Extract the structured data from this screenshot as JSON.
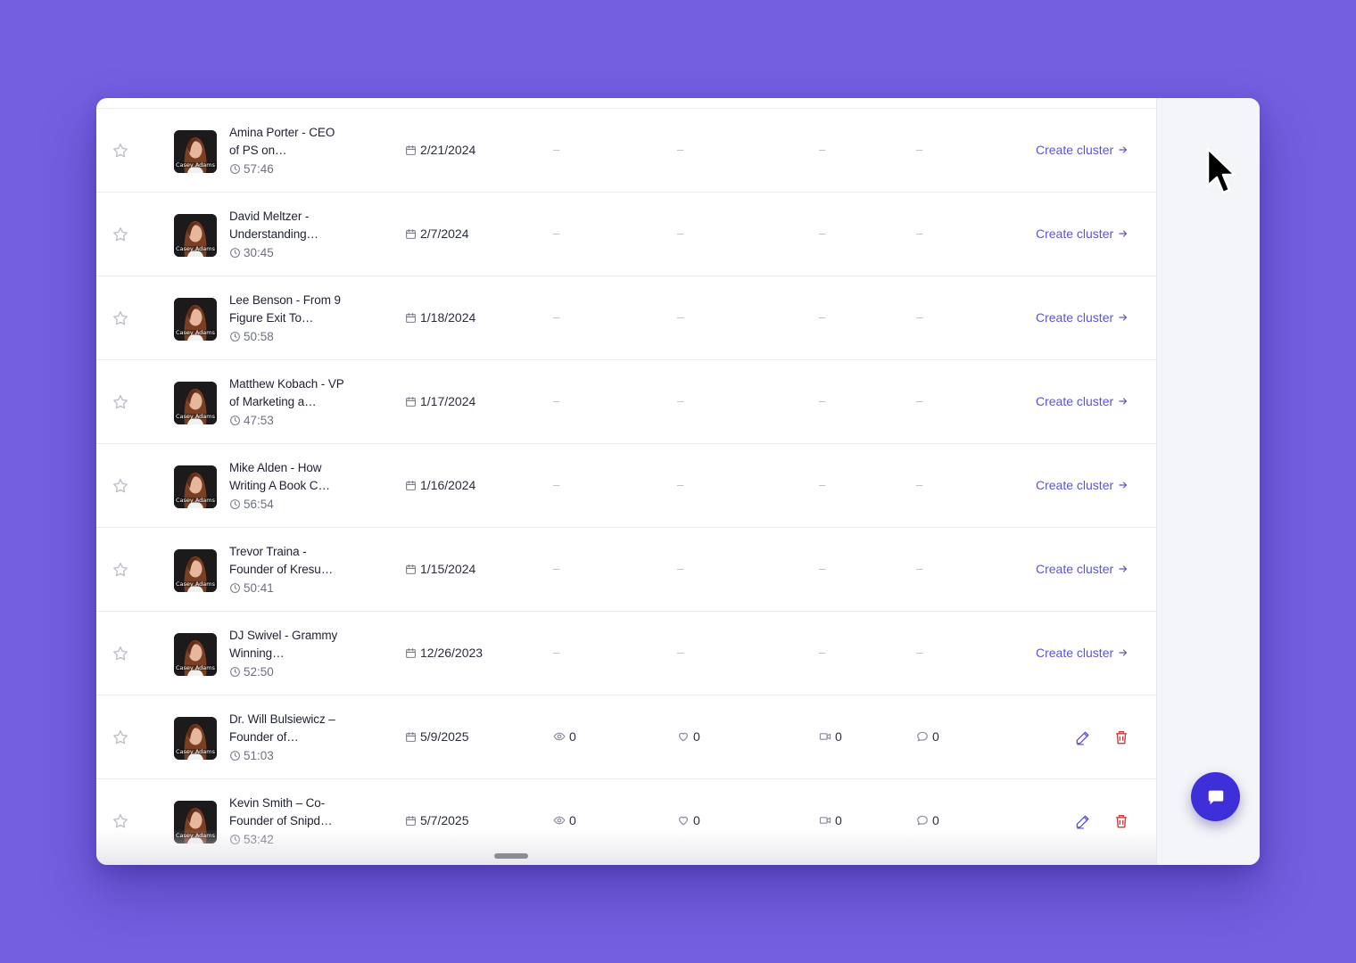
{
  "app": {
    "action_label": "Create cluster",
    "empty_value": "–"
  },
  "rows": [
    {
      "title": "Amina Porter - CEO of PS on…",
      "duration": "57:46",
      "date": "2/21/2024",
      "type": "unclustered"
    },
    {
      "title": "David Meltzer - Understanding…",
      "duration": "30:45",
      "date": "2/7/2024",
      "type": "unclustered"
    },
    {
      "title": "Lee Benson - From 9 Figure Exit To…",
      "duration": "50:58",
      "date": "1/18/2024",
      "type": "unclustered"
    },
    {
      "title": "Matthew Kobach - VP of Marketing a…",
      "duration": "47:53",
      "date": "1/17/2024",
      "type": "unclustered"
    },
    {
      "title": "Mike Alden - How Writing A Book C…",
      "duration": "56:54",
      "date": "1/16/2024",
      "type": "unclustered"
    },
    {
      "title": "Trevor Traina - Founder of Kresu…",
      "duration": "50:41",
      "date": "1/15/2024",
      "type": "unclustered"
    },
    {
      "title": "DJ Swivel - Grammy Winning…",
      "duration": "52:50",
      "date": "12/26/2023",
      "type": "unclustered"
    },
    {
      "title": "Dr. Will Bulsiewicz – Founder of…",
      "duration": "51:03",
      "date": "5/9/2025",
      "type": "clustered",
      "views": "0",
      "likes": "0",
      "videos": "0",
      "comments": "0"
    },
    {
      "title": "Kevin Smith – Co-Founder of Snipd…",
      "duration": "53:42",
      "date": "5/7/2025",
      "type": "clustered",
      "views": "0",
      "likes": "0",
      "videos": "0",
      "comments": "0"
    }
  ],
  "avatar_caption": "Casey Adams",
  "colors": {
    "background": "#735fe0",
    "accent": "#5b55d6",
    "chat_button": "#3f2fd9",
    "delete": "#d23b3b"
  },
  "icons": {
    "favorite": "star-outline-icon",
    "date": "calendar-icon",
    "duration": "clock-icon",
    "views": "eye-icon",
    "likes": "heart-icon",
    "videos": "video-icon",
    "comments": "comment-icon",
    "edit": "pencil-icon",
    "delete": "trash-icon",
    "chat": "chat-bubble-icon"
  }
}
